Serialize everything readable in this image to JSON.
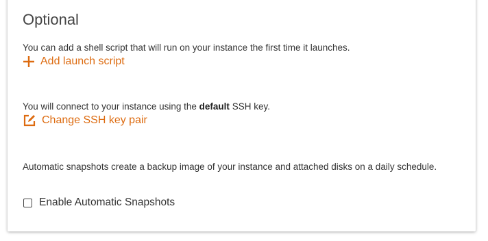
{
  "section": {
    "title": "Optional",
    "launch_script": {
      "description": "You can add a shell script that will run on your instance the first time it launches.",
      "link_label": "Add launch script",
      "icon": "plus-icon"
    },
    "ssh_key": {
      "description_prefix": "You will connect to your instance using the ",
      "description_bold": "default",
      "description_suffix": " SSH key.",
      "link_label": "Change SSH key pair",
      "icon": "edit-icon"
    },
    "snapshots": {
      "description": "Automatic snapshots create a backup image of your instance and attached disks on a daily schedule.",
      "checkbox_label": "Enable Automatic Snapshots",
      "checked": false
    }
  },
  "colors": {
    "accent": "#dd6b10",
    "text": "#333333"
  }
}
